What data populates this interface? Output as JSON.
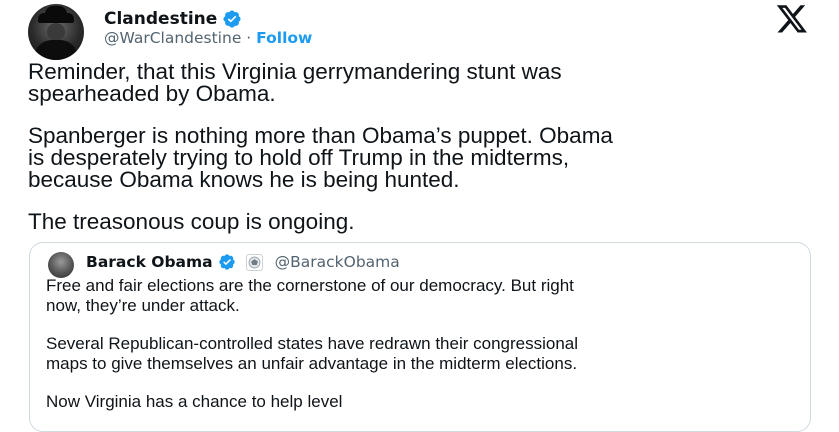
{
  "author": {
    "display_name": "Clandestine",
    "handle": "@WarClandestine",
    "separator": "·",
    "follow_label": "Follow"
  },
  "tweet": {
    "paragraphs": [
      [
        "Reminder, that this Virginia gerrymandering stunt was",
        "spearheaded by Obama."
      ],
      [
        "Spanberger is nothing more than Obama’s puppet. Obama",
        "is desperately trying to hold off Trump in the midterms,",
        "because Obama knows he is being hunted."
      ],
      [
        "The treasonous coup is ongoing."
      ]
    ]
  },
  "quoted_tweet": {
    "display_name": "Barack Obama",
    "handle": "@BarackObama",
    "paragraphs": [
      [
        "Free and fair elections are the cornerstone of our democracy. But right",
        "now, they’re under attack."
      ],
      [
        "Several Republican-controlled states have redrawn their congressional",
        "maps to give themselves an unfair advantage in the midterm elections."
      ],
      [
        "Now Virginia has a chance to help level"
      ]
    ]
  },
  "icons": {
    "verified": "verified-badge-icon",
    "platform": "x-logo-icon",
    "affiliation": "government-seal-icon"
  },
  "colors": {
    "accent": "#1d9bf0",
    "text": "#0f1419",
    "secondary_text": "#536471",
    "border": "#cfd9de"
  }
}
